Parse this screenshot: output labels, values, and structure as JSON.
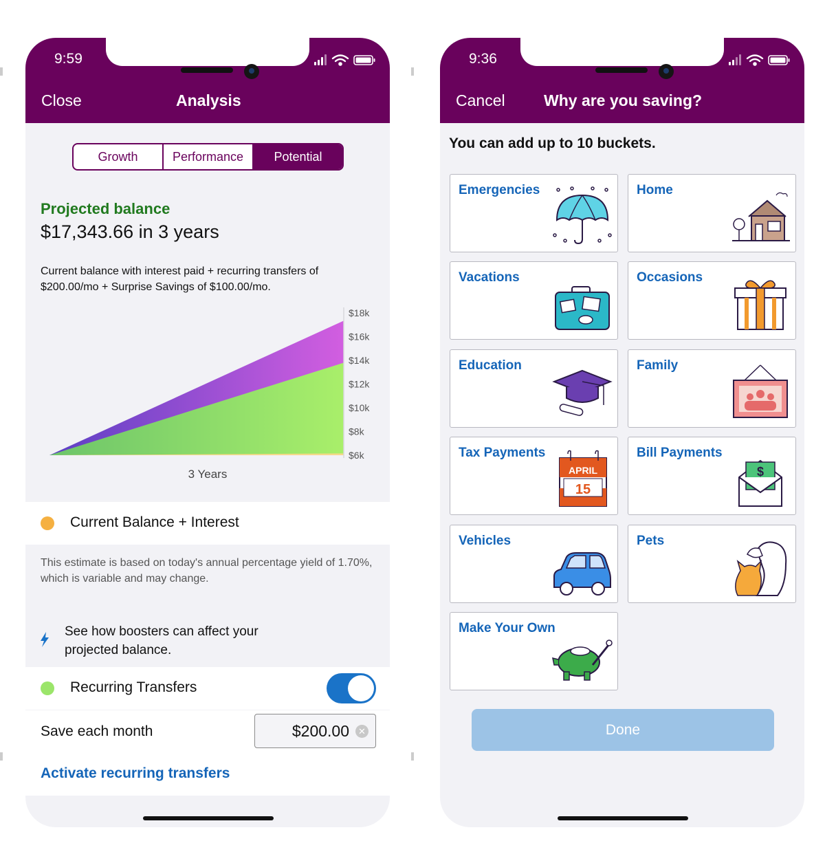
{
  "left_phone": {
    "status_time": "9:59",
    "nav": {
      "close_label": "Close",
      "title": "Analysis"
    },
    "segments": [
      {
        "label": "Growth",
        "active": false
      },
      {
        "label": "Performance",
        "active": false
      },
      {
        "label": "Potential",
        "active": true
      }
    ],
    "projection": {
      "label": "Projected balance",
      "amount": "$17,343.66 in 3 years",
      "description": "Current balance with interest paid + recurring transfers of $200.00/mo + Surprise Savings of $100.00/mo."
    },
    "legend_current": "Current Balance + Interest",
    "estimate_note": "This estimate is based on today's annual percentage yield of 1.70%, which is variable and may change.",
    "boosters_text": "See how boosters can affect your projected balance.",
    "recurring_label": "Recurring Transfers",
    "recurring_enabled": true,
    "save_each_month_label": "Save each month",
    "save_amount": "$200.00",
    "activate_link": "Activate recurring transfers",
    "colors": {
      "brand": "#69025c",
      "green_text": "#217a1f",
      "link": "#1565b8",
      "orange_dot": "#f5b041",
      "green_dot": "#9be56a"
    }
  },
  "chart_data": {
    "type": "area",
    "x": [
      0,
      3
    ],
    "xlabel": "3 Years",
    "ylabel": "",
    "yticks": [
      "$18k",
      "$16k",
      "$14k",
      "$12k",
      "$10k",
      "$8k",
      "$6k"
    ],
    "ylim": [
      6000,
      18000
    ],
    "series": [
      {
        "name": "Current Balance + Interest",
        "values": [
          6000,
          6150
        ],
        "color": "#f5d98a"
      },
      {
        "name": "Recurring Transfers",
        "values": [
          6000,
          13800
        ],
        "color": "#a4e86a"
      },
      {
        "values": [
          6000,
          17343.66
        ],
        "color": "#c35ad8"
      }
    ]
  },
  "right_phone": {
    "status_time": "9:36",
    "nav": {
      "cancel_label": "Cancel",
      "title": "Why are you saving?"
    },
    "intro": "You can add up to 10 buckets.",
    "buckets": [
      {
        "label": "Emergencies",
        "icon": "umbrella-icon"
      },
      {
        "label": "Home",
        "icon": "house-icon"
      },
      {
        "label": "Vacations",
        "icon": "suitcase-icon"
      },
      {
        "label": "Occasions",
        "icon": "gift-icon"
      },
      {
        "label": "Education",
        "icon": "graduation-cap-icon"
      },
      {
        "label": "Family",
        "icon": "family-photo-icon"
      },
      {
        "label": "Tax Payments",
        "icon": "calendar-icon",
        "calendar_month": "APRIL",
        "calendar_day": "15"
      },
      {
        "label": "Bill Payments",
        "icon": "bill-envelope-icon"
      },
      {
        "label": "Vehicles",
        "icon": "car-icon"
      },
      {
        "label": "Pets",
        "icon": "pets-icon"
      },
      {
        "label": "Make Your Own",
        "icon": "piggy-bank-icon"
      }
    ],
    "done_label": "Done"
  }
}
